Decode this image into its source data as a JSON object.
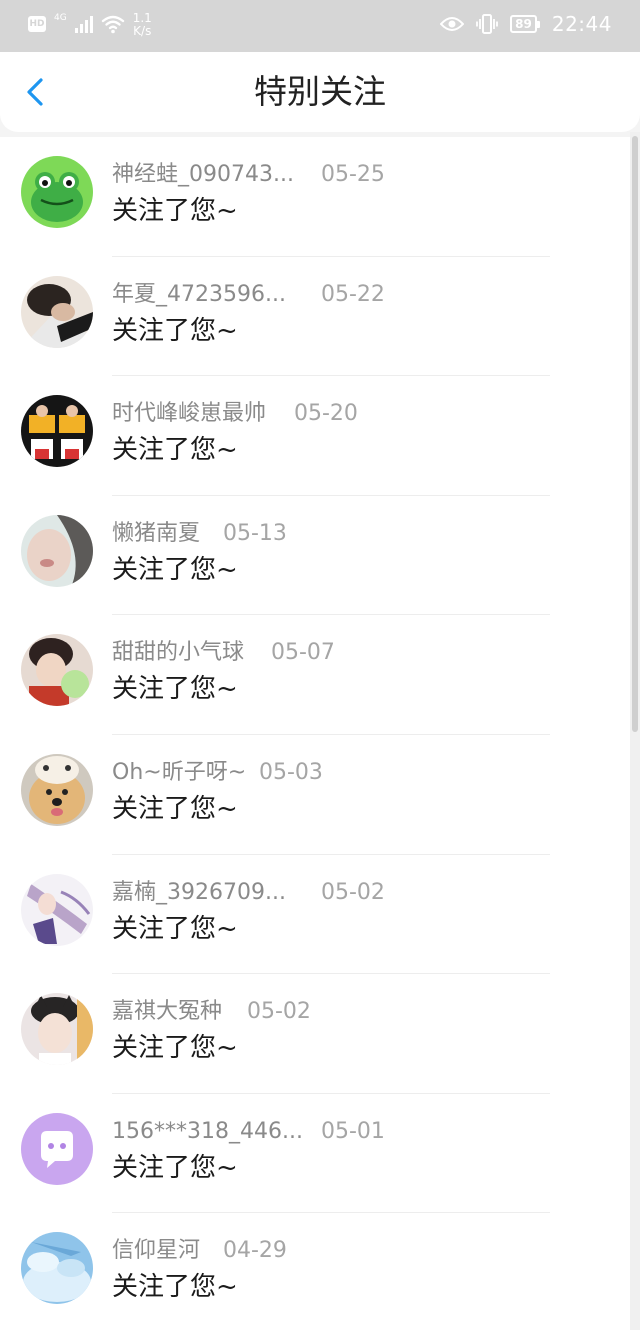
{
  "status_bar": {
    "hd": "HD",
    "network": "4G",
    "speed_value": "1.1",
    "speed_unit": "K/s",
    "battery": "89",
    "time": "22:44"
  },
  "header": {
    "title": "特别关注"
  },
  "notifications": [
    {
      "name": "神经蛙_090743...",
      "date": "05-25",
      "message": "关注了您~"
    },
    {
      "name": "年夏_4723596...",
      "date": "05-22",
      "message": "关注了您~"
    },
    {
      "name": "时代峰峻崽最帅",
      "date": "05-20",
      "message": "关注了您~"
    },
    {
      "name": "懒猪南夏",
      "date": "05-13",
      "message": "关注了您~"
    },
    {
      "name": "甜甜的小气球",
      "date": "05-07",
      "message": "关注了您~"
    },
    {
      "name": "Oh~昕子呀~",
      "date": "05-03",
      "message": "关注了您~"
    },
    {
      "name": "嘉楠_3926709...",
      "date": "05-02",
      "message": "关注了您~"
    },
    {
      "name": "嘉祺大冤种",
      "date": "05-02",
      "message": "关注了您~"
    },
    {
      "name": "156***318_446...",
      "date": "05-01",
      "message": "关注了您~"
    },
    {
      "name": "信仰星河",
      "date": "04-29",
      "message": "关注了您~"
    }
  ],
  "colors": {
    "accent": "#1e96f0",
    "status_bar_bg": "#d6d6d6",
    "name_text": "#8a8a8a",
    "date_text": "#a5a5a5",
    "message_text": "#1b1b1b"
  },
  "icons": {
    "back": "chevron-left-icon",
    "hd": "hd-icon",
    "signal": "signal-icon",
    "wifi": "wifi-icon",
    "eye": "eye-icon",
    "vibrate": "vibrate-icon",
    "battery": "battery-icon"
  }
}
